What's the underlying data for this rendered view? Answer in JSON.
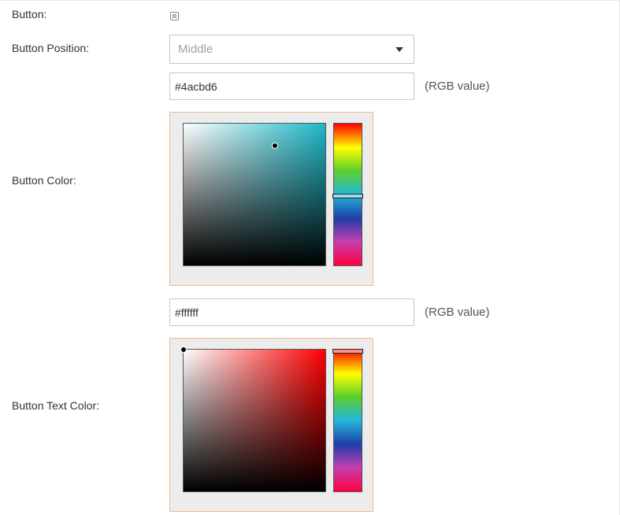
{
  "button_row": {
    "label": "Button:",
    "collapse_icon": "collapse-up-icon"
  },
  "position_row": {
    "label": "Button Position:",
    "selected": "Middle"
  },
  "button_color": {
    "label": "Button Color:",
    "value": "#4acbd6",
    "hint": "(RGB value)",
    "hue_color": "#1fb8c8"
  },
  "button_text_color": {
    "label": "Button Text Color:",
    "value": "#ffffff",
    "hint": "(RGB value)",
    "hue_color": "#ff0000"
  }
}
